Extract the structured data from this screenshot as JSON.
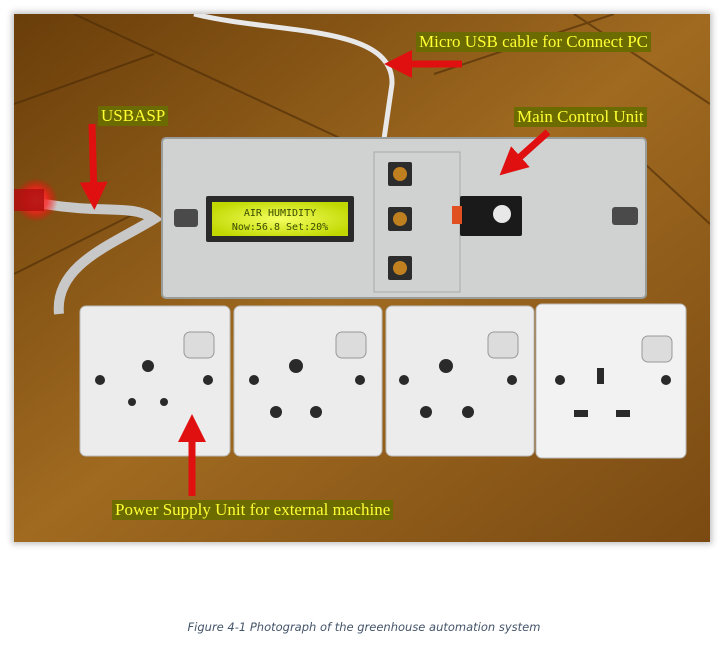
{
  "photo": {
    "labels": {
      "usb_cable": "Micro USB cable for Connect PC",
      "usbasp": "USBASP",
      "main_control": "Main Control Unit",
      "power_supply": "Power Supply Unit for external machine"
    },
    "lcd": {
      "line1": "AIR HUMIDITY",
      "line2": "Now:56.8 Set:20%"
    },
    "colors": {
      "label_text": "#ffff33",
      "label_bg": "#6b6b00",
      "arrow": "#e01010",
      "table": "#8a5a18",
      "lcd_bg": "#c8e000"
    }
  },
  "caption": "Figure 4-1 Photograph of the greenhouse automation system"
}
